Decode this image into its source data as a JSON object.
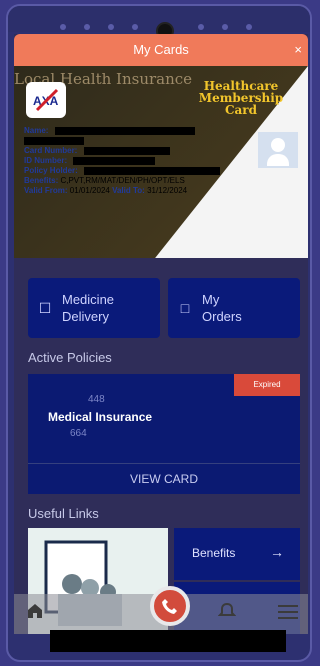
{
  "modal": {
    "title": "My Cards",
    "close": "×"
  },
  "card": {
    "bg_title": "Local Health Insurance",
    "type_label": "Healthcare Membership Card",
    "lines": [
      {
        "label": "Name:",
        "value": ""
      },
      {
        "label": "Card Number:",
        "value": ""
      },
      {
        "label": "ID Number:",
        "value": ""
      },
      {
        "label": "Policy Holder:",
        "value": ""
      },
      {
        "label": "Benefits:",
        "value": "C,PVT,RM/MAT/DEN/PH/OPT/ELS"
      },
      {
        "label": "Valid From:",
        "value": "01/01/2024"
      }
    ],
    "valid_to_label": "Valid To:",
    "valid_to_value": "31/12/2024"
  },
  "tiles": [
    {
      "label_line1": "Medicine",
      "label_line2": "Delivery",
      "icon": "truck-icon"
    },
    {
      "label_line1": "My",
      "label_line2": "Orders",
      "icon": "document-icon"
    }
  ],
  "sections": {
    "active_policies": "Active Policies",
    "useful_links": "Useful Links"
  },
  "policy": {
    "badge": "Expired",
    "name": "Medical Insurance",
    "num1": "448",
    "num2": "664",
    "cta": "VIEW CARD"
  },
  "links": [
    {
      "label": "Benefits",
      "icon": "arrow-right-icon"
    }
  ]
}
